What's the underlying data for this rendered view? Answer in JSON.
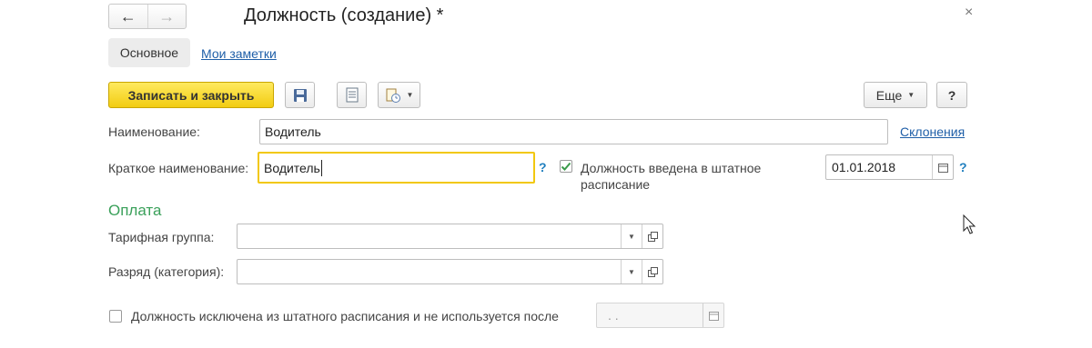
{
  "window": {
    "title": "Должность (создание) *",
    "back_icon": "arrow-left-icon",
    "forward_icon": "arrow-right-icon",
    "close_label": "×"
  },
  "tabs": [
    {
      "label": "Основное",
      "active": true
    },
    {
      "label": "Мои заметки",
      "active": false
    }
  ],
  "toolbar": {
    "save_close_label": "Записать и закрыть",
    "save_icon": "floppy-disk-icon",
    "report_icon": "document-list-icon",
    "print_icon": "print-report-icon",
    "more_label": "Еще",
    "help_label": "?"
  },
  "form": {
    "name_label": "Наименование:",
    "name_value": "Водитель",
    "declensions_link": "Склонения",
    "short_name_label": "Краткое наименование:",
    "short_name_value": "Водитель",
    "short_name_help": "?",
    "staffed_checked": true,
    "staffed_label_line1": "Должность введена в штатное",
    "staffed_label_line2": "расписание",
    "staffed_date": "01.01.2018",
    "staffed_date_help": "?",
    "payment_section": "Оплата",
    "tariff_group_label": "Тарифная группа:",
    "tariff_group_value": "",
    "grade_label": "Разряд (категория):",
    "grade_value": "",
    "excluded_checked": false,
    "excluded_label": "Должность исключена из штатного расписания и не используется после",
    "excluded_date_placeholder": " .  ."
  },
  "colors": {
    "primary_button": "#f2cc12",
    "link": "#1f5fa8",
    "section_header": "#3aa05a",
    "focus_border": "#f2c80f"
  }
}
